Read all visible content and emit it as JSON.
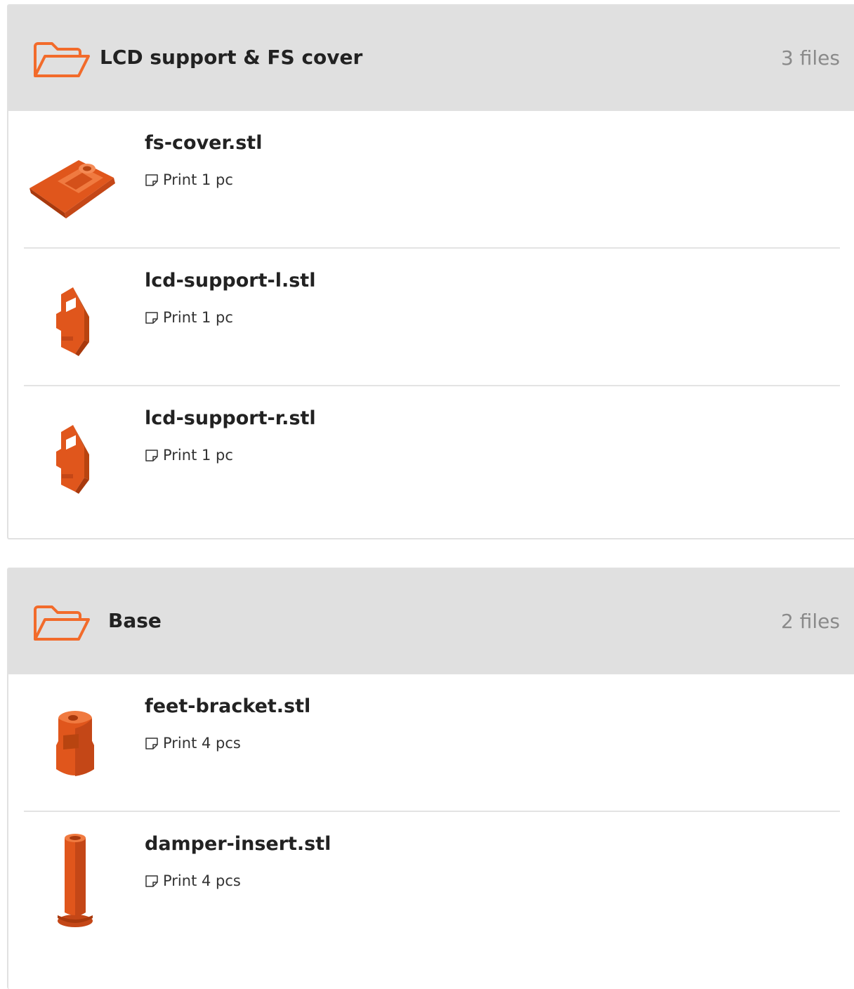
{
  "accent_color": "#f26b2b",
  "groups": [
    {
      "title": "LCD support & FS cover",
      "count": "3 files",
      "icon": "folder-open-icon",
      "files": [
        {
          "name": "fs-cover.stl",
          "print": "Print 1 pc",
          "thumb": "fs-cover-thumbnail"
        },
        {
          "name": "lcd-support-l.stl",
          "print": "Print 1 pc",
          "thumb": "lcd-support-l-thumbnail"
        },
        {
          "name": "lcd-support-r.stl",
          "print": "Print 1 pc",
          "thumb": "lcd-support-r-thumbnail"
        }
      ]
    },
    {
      "title": "Base",
      "count": "2 files",
      "icon": "folder-open-icon",
      "files": [
        {
          "name": "feet-bracket.stl",
          "print": "Print 4 pcs",
          "thumb": "feet-bracket-thumbnail"
        },
        {
          "name": "damper-insert.stl",
          "print": "Print 4 pcs",
          "thumb": "damper-insert-thumbnail"
        }
      ]
    }
  ]
}
